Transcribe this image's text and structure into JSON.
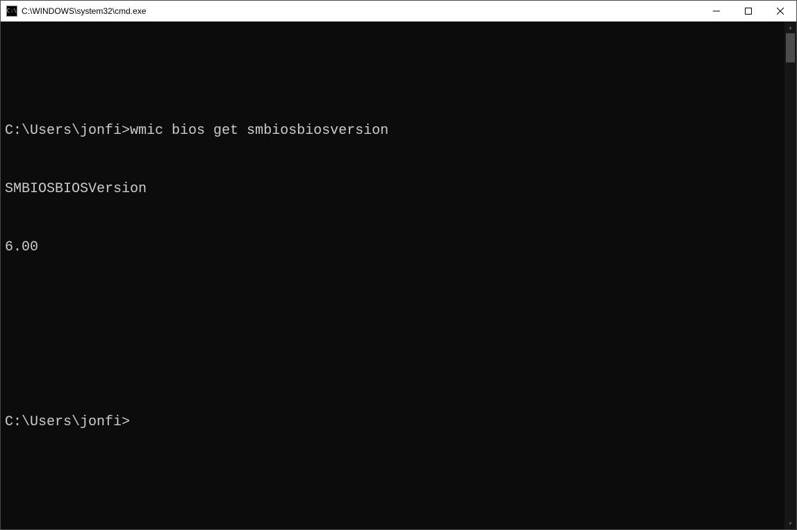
{
  "window": {
    "title": "C:\\WINDOWS\\system32\\cmd.exe",
    "icon_text": "C:\\"
  },
  "terminal": {
    "prompt1": "C:\\Users\\jonfi>",
    "command1": "wmic bios get smbiosbiosversion",
    "output_header": "SMBIOSBIOSVersion",
    "output_value": "6.00",
    "prompt2": "C:\\Users\\jonfi>"
  },
  "scrollbar": {
    "up": "▴",
    "down": "▾"
  }
}
